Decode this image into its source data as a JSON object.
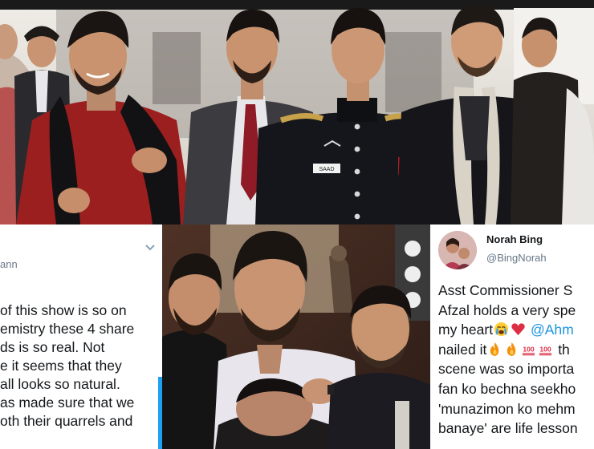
{
  "tweet_left": {
    "handle": "ann",
    "lines": [
      "of this show is so on",
      "emistry these 4 share",
      "ds is so real. Not",
      "e it seems that they",
      "all looks so natural.",
      "as made sure that we",
      "oth their quarrels and"
    ]
  },
  "tweet_right": {
    "name": "Norah Bing",
    "username": "@BingNorah",
    "line1": "Asst Commissioner S",
    "line2": "Afzal holds a very spe",
    "line3_text": "my heart",
    "line3_mention": "@Ahm",
    "line4_text": "nailed it",
    "line4_tail": " th",
    "line5": "scene was so importa",
    "line6": "fan ko bechna seekho",
    "line7": "'munazimon ko mehm",
    "line8": "banaye' are life lesson"
  },
  "top_photo": {
    "badge_text": "SAAD"
  },
  "colors": {
    "link": "#1b95e0",
    "accent_stripe": "#1da1f2",
    "uniform": "#15161c",
    "red_kurta": "#9c1f1f"
  },
  "icons": [
    "chevron-down-icon",
    "crying-face-icon",
    "red-heart-icon",
    "fire-icon",
    "hundred-points-icon"
  ]
}
